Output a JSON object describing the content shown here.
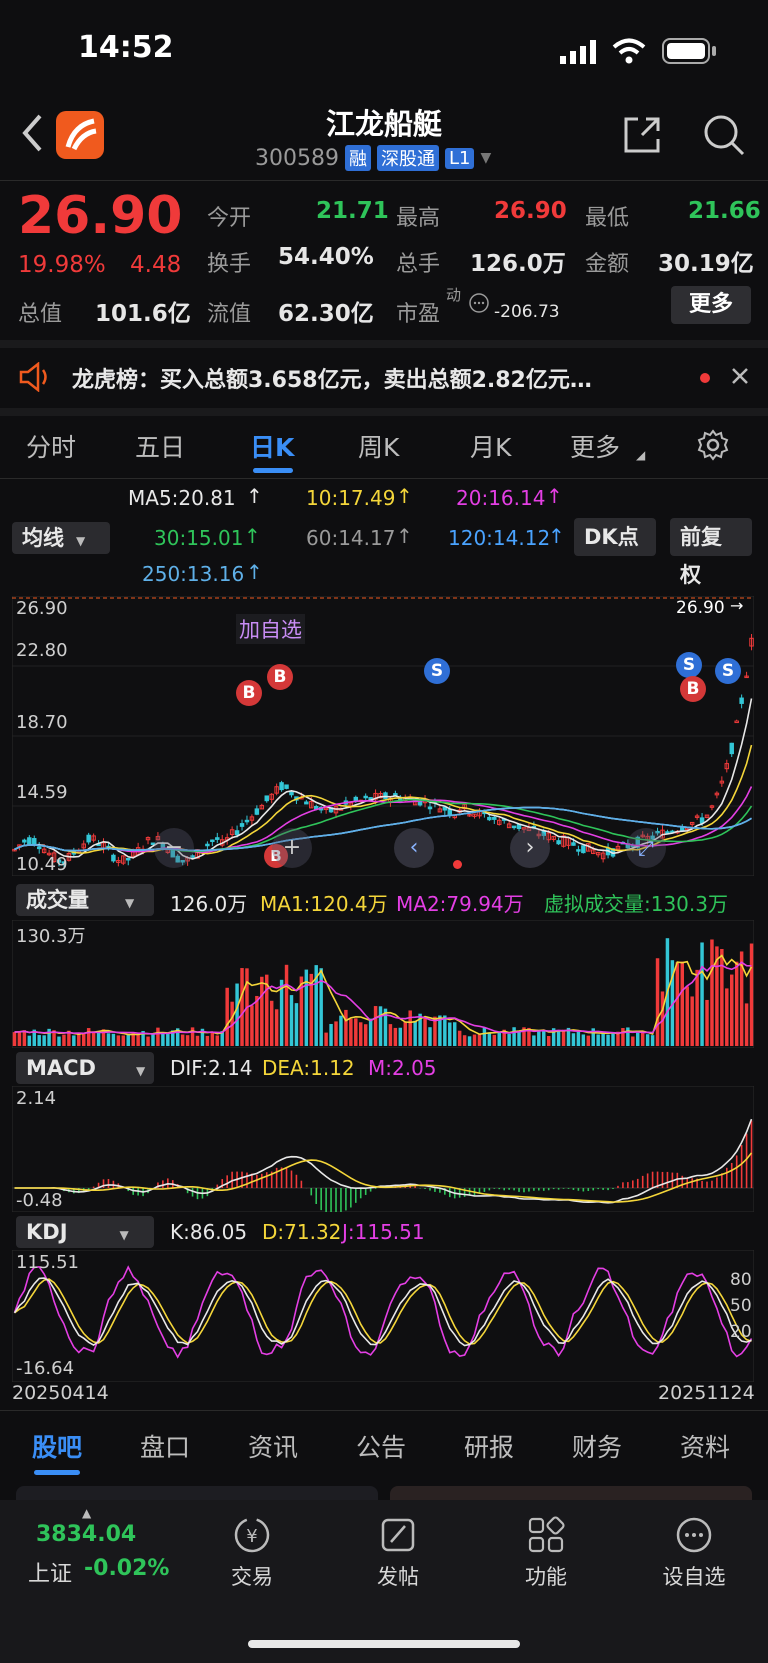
{
  "status": {
    "time": "14:52"
  },
  "header": {
    "title": "江龙船艇",
    "code": "300589",
    "tag_rong": "融",
    "tag_sgt": "深股通",
    "tag_l1": "L1"
  },
  "quote": {
    "price": "26.90",
    "change_pct": "19.98%",
    "change": "4.48",
    "open_label": "今开",
    "open": "21.71",
    "high_label": "最高",
    "high": "26.90",
    "low_label": "最低",
    "low": "21.66",
    "turnover_label": "换手",
    "turnover": "54.40%",
    "volume_label": "总手",
    "volume": "126.0万",
    "amount_label": "金额",
    "amount": "30.19亿",
    "mcap_label": "总值",
    "mcap": "101.6亿",
    "float_label": "流值",
    "float": "62.30亿",
    "pe_label": "市盈",
    "pe_sup": "动",
    "pe": "-206.73",
    "more": "更多"
  },
  "notice": {
    "text": "龙虎榜：买入总额3.658亿元，卖出总额2.82亿元…"
  },
  "tabs": [
    "分时",
    "五日",
    "日K",
    "周K",
    "月K",
    "更多"
  ],
  "ma": {
    "selector": "均线",
    "ma5": "MA5:20.81",
    "ma10": "10:17.49",
    "ma20": "20:16.14",
    "ma30": "30:15.01",
    "ma60": "60:14.17",
    "ma120": "120:14.12",
    "ma250": "250:13.16",
    "dk_button": "DK点",
    "fq_button": "前复权"
  },
  "kline": {
    "y_labels": [
      "26.90",
      "22.80",
      "18.70",
      "14.59",
      "10.49"
    ],
    "last_price_tag": "26.90",
    "add_watch": "加自选",
    "marker_b": "B",
    "marker_s": "S"
  },
  "volume": {
    "selector": "成交量",
    "value": "126.0万",
    "ma1": "MA1:120.4万",
    "ma2": "MA2:79.94万",
    "virtual": "虚拟成交量:130.3万",
    "max_label": "130.3万"
  },
  "macd": {
    "selector": "MACD",
    "dif": "DIF:2.14",
    "dea": "DEA:1.12",
    "m": "M:2.05",
    "max_label": "2.14",
    "min_label": "-0.48"
  },
  "kdj": {
    "selector": "KDJ",
    "k": "K:86.05",
    "d": "D:71.32",
    "j": "J:115.51",
    "max_label": "115.51",
    "min_label": "-16.64",
    "level_80": "80",
    "level_50": "50",
    "level_20": "20",
    "date_start": "20250414",
    "date_end": "20251124"
  },
  "bottom_tabs": [
    "股吧",
    "盘口",
    "资讯",
    "公告",
    "研报",
    "财务",
    "资料"
  ],
  "dock": {
    "index_value": "3834.04",
    "index_name": "上证",
    "index_change": "-0.02%",
    "trade": "交易",
    "post": "发帖",
    "func": "功能",
    "watch": "设自选"
  },
  "colors": {
    "up": "#f03a3a",
    "down": "#2fc45a",
    "accent": "#3a8ef6",
    "bg": "#0e0e10"
  }
}
